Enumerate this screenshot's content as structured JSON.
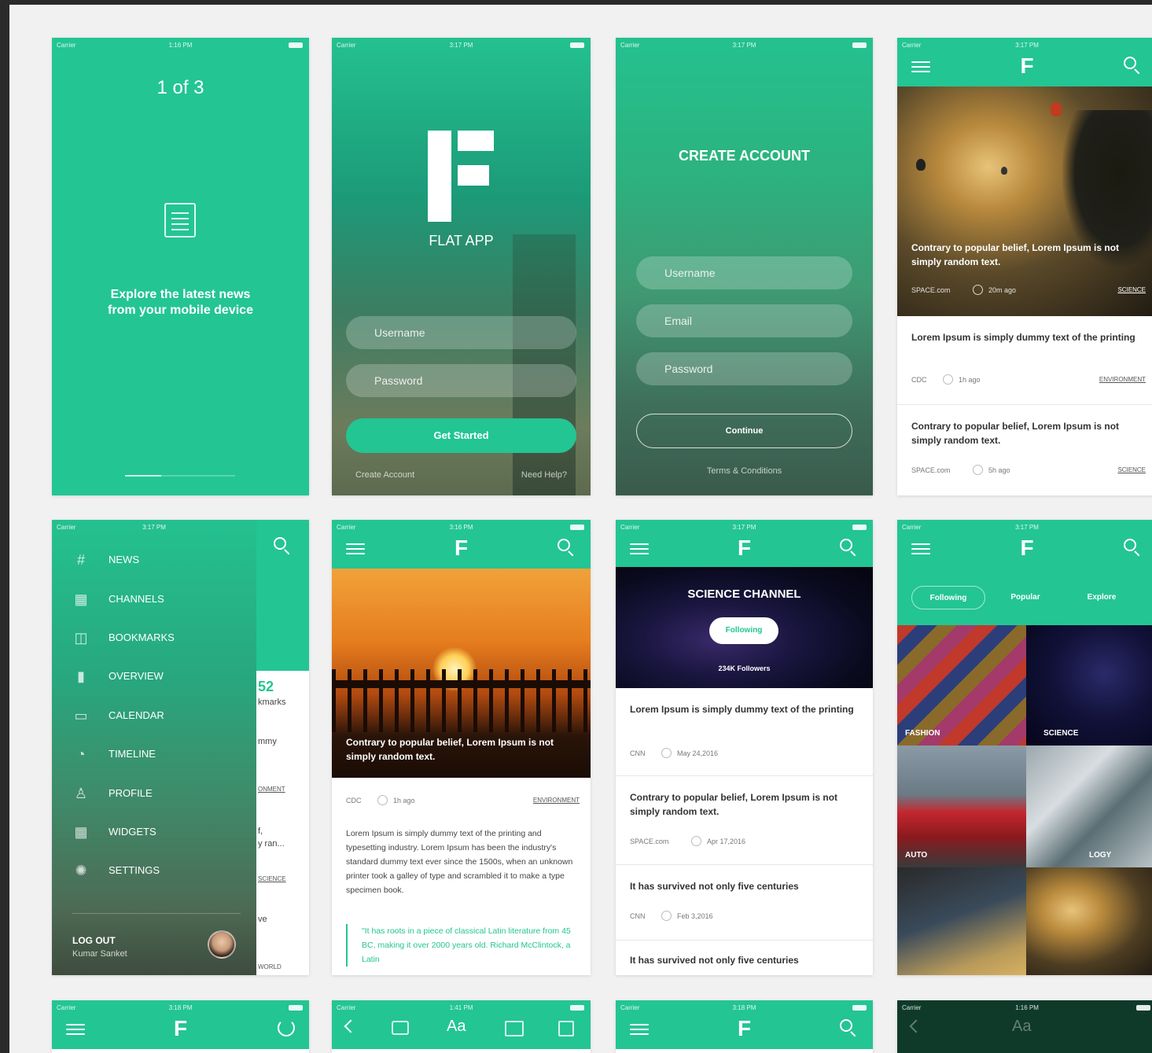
{
  "colors": {
    "accent": "#23c593",
    "background": "#f1f1f1",
    "frame": "#2a2a2a"
  },
  "status": {
    "carrier": "Carrier",
    "times": [
      "1:16 PM",
      "3:17 PM",
      "3:17 PM",
      "3:17 PM",
      "3:17 PM",
      "3:16 PM",
      "3:17 PM",
      "3:17 PM",
      "3:18 PM",
      "1:41 PM",
      "3:18 PM",
      "1:16 PM"
    ]
  },
  "onboarding": {
    "counter": "1 of 3",
    "icon": "document-icon",
    "text_line1": "Explore the latest news",
    "text_line2": "from your mobile device"
  },
  "login": {
    "app_name": "FLAT APP",
    "username_placeholder": "Username",
    "password_placeholder": "Password",
    "get_started": "Get Started",
    "create_account": "Create Account",
    "need_help": "Need Help?"
  },
  "signup": {
    "title": "CREATE ACCOUNT",
    "username_placeholder": "Username",
    "email_placeholder": "Email",
    "password_placeholder": "Password",
    "continue": "Continue",
    "terms": "Terms & Conditions"
  },
  "logo": "F",
  "feed": {
    "hero_title": "Contrary to popular belief, Lorem Ipsum is not simply random text.",
    "hero_source": "SPACE.com",
    "hero_ago": "20m ago",
    "hero_category": "SCIENCE",
    "articles": [
      {
        "title": "Lorem Ipsum is simply dummy text of the printing",
        "source": "CDC",
        "ago": "1h ago",
        "category": "ENVIRONMENT"
      },
      {
        "title": "Contrary to popular belief, Lorem Ipsum is not simply random text.",
        "source": "SPACE.com",
        "ago": "5h ago",
        "category": "SCIENCE"
      }
    ]
  },
  "menu": {
    "items": [
      {
        "label": "NEWS",
        "icon": "#"
      },
      {
        "label": "CHANNELS",
        "icon": "▦"
      },
      {
        "label": "BOOKMARKS",
        "icon": "◫"
      },
      {
        "label": "OVERVIEW",
        "icon": "▮"
      },
      {
        "label": "CALENDAR",
        "icon": "▭"
      },
      {
        "label": "TIMELINE",
        "icon": "◔"
      },
      {
        "label": "PROFILE",
        "icon": "♙"
      },
      {
        "label": "WIDGETS",
        "icon": "▦"
      },
      {
        "label": "SETTINGS",
        "icon": "✺"
      }
    ],
    "logout": "LOG OUT",
    "user_name": "Kumar Sanket",
    "peek": {
      "count": "52",
      "count_label": "kmarks",
      "t1": "mmy",
      "c1": "ONMENT",
      "t2": "f,",
      "t3": "y ran...",
      "c2": "SCIENCE",
      "t4": "ve",
      "c3": "WORLD"
    }
  },
  "detail": {
    "hero_title": "Contrary to popular belief, Lorem Ipsum is not simply random text.",
    "source": "CDC",
    "ago": "1h ago",
    "category": "ENVIRONMENT",
    "body": "Lorem Ipsum is simply dummy text of the printing and typesetting industry. Lorem Ipsum has been the industry's standard dummy text ever since the 1500s, when an unknown printer took a galley of type and scrambled it to make a type specimen book.",
    "quote": "\"It has roots in a piece of classical Latin literature from 45 BC, making it over 2000 years old. Richard McClintock, a Latin"
  },
  "channel": {
    "title": "SCIENCE CHANNEL",
    "following": "Following",
    "followers": "234K Followers",
    "articles": [
      {
        "title": "Lorem Ipsum is simply dummy text of the printing",
        "source": "CNN",
        "date": "May 24,2016"
      },
      {
        "title": "Contrary to popular belief, Lorem Ipsum is not simply random text.",
        "source": "SPACE.com",
        "date": "Apr 17,2016"
      },
      {
        "title": "It has survived not only five centuries",
        "source": "CNN",
        "date": "Feb 3,2016"
      },
      {
        "title": "It has survived not only five centuries",
        "source": "",
        "date": ""
      }
    ]
  },
  "explore": {
    "tabs": [
      "Following",
      "Popular",
      "Explore"
    ],
    "tiles": [
      "FASHION",
      "SCIENCE",
      "AUTO",
      "LOGY",
      "",
      ""
    ]
  },
  "bottom_row": {
    "reader_font": "Aa"
  }
}
